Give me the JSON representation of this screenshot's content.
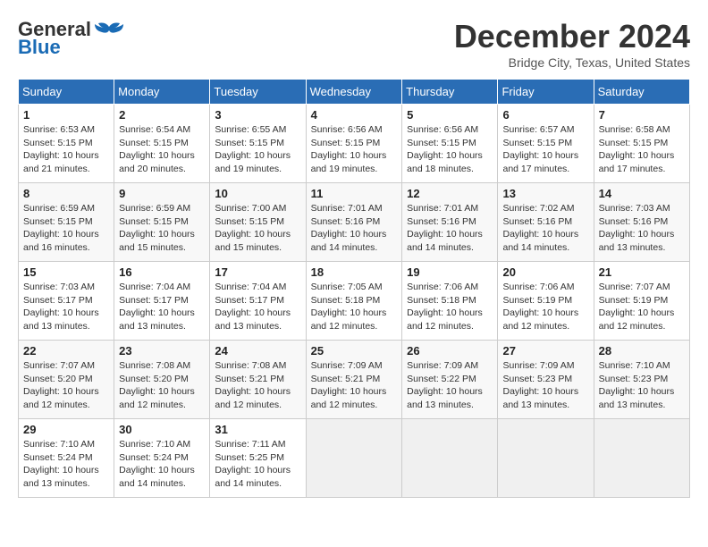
{
  "header": {
    "logo_general": "General",
    "logo_blue": "Blue",
    "month_title": "December 2024",
    "location": "Bridge City, Texas, United States"
  },
  "calendar": {
    "days_of_week": [
      "Sunday",
      "Monday",
      "Tuesday",
      "Wednesday",
      "Thursday",
      "Friday",
      "Saturday"
    ],
    "weeks": [
      [
        {
          "day": null,
          "empty": true
        },
        {
          "day": null,
          "empty": true
        },
        {
          "day": null,
          "empty": true
        },
        {
          "day": null,
          "empty": true
        },
        {
          "day": null,
          "empty": true
        },
        {
          "day": null,
          "empty": true
        },
        {
          "day": null,
          "empty": true
        }
      ],
      [
        {
          "day": 1,
          "sunrise": "6:53 AM",
          "sunset": "5:15 PM",
          "daylight": "10 hours and 21 minutes."
        },
        {
          "day": 2,
          "sunrise": "6:54 AM",
          "sunset": "5:15 PM",
          "daylight": "10 hours and 20 minutes."
        },
        {
          "day": 3,
          "sunrise": "6:55 AM",
          "sunset": "5:15 PM",
          "daylight": "10 hours and 19 minutes."
        },
        {
          "day": 4,
          "sunrise": "6:56 AM",
          "sunset": "5:15 PM",
          "daylight": "10 hours and 19 minutes."
        },
        {
          "day": 5,
          "sunrise": "6:56 AM",
          "sunset": "5:15 PM",
          "daylight": "10 hours and 18 minutes."
        },
        {
          "day": 6,
          "sunrise": "6:57 AM",
          "sunset": "5:15 PM",
          "daylight": "10 hours and 17 minutes."
        },
        {
          "day": 7,
          "sunrise": "6:58 AM",
          "sunset": "5:15 PM",
          "daylight": "10 hours and 17 minutes."
        }
      ],
      [
        {
          "day": 8,
          "sunrise": "6:59 AM",
          "sunset": "5:15 PM",
          "daylight": "10 hours and 16 minutes."
        },
        {
          "day": 9,
          "sunrise": "6:59 AM",
          "sunset": "5:15 PM",
          "daylight": "10 hours and 15 minutes."
        },
        {
          "day": 10,
          "sunrise": "7:00 AM",
          "sunset": "5:15 PM",
          "daylight": "10 hours and 15 minutes."
        },
        {
          "day": 11,
          "sunrise": "7:01 AM",
          "sunset": "5:16 PM",
          "daylight": "10 hours and 14 minutes."
        },
        {
          "day": 12,
          "sunrise": "7:01 AM",
          "sunset": "5:16 PM",
          "daylight": "10 hours and 14 minutes."
        },
        {
          "day": 13,
          "sunrise": "7:02 AM",
          "sunset": "5:16 PM",
          "daylight": "10 hours and 14 minutes."
        },
        {
          "day": 14,
          "sunrise": "7:03 AM",
          "sunset": "5:16 PM",
          "daylight": "10 hours and 13 minutes."
        }
      ],
      [
        {
          "day": 15,
          "sunrise": "7:03 AM",
          "sunset": "5:17 PM",
          "daylight": "10 hours and 13 minutes."
        },
        {
          "day": 16,
          "sunrise": "7:04 AM",
          "sunset": "5:17 PM",
          "daylight": "10 hours and 13 minutes."
        },
        {
          "day": 17,
          "sunrise": "7:04 AM",
          "sunset": "5:17 PM",
          "daylight": "10 hours and 13 minutes."
        },
        {
          "day": 18,
          "sunrise": "7:05 AM",
          "sunset": "5:18 PM",
          "daylight": "10 hours and 12 minutes."
        },
        {
          "day": 19,
          "sunrise": "7:06 AM",
          "sunset": "5:18 PM",
          "daylight": "10 hours and 12 minutes."
        },
        {
          "day": 20,
          "sunrise": "7:06 AM",
          "sunset": "5:19 PM",
          "daylight": "10 hours and 12 minutes."
        },
        {
          "day": 21,
          "sunrise": "7:07 AM",
          "sunset": "5:19 PM",
          "daylight": "10 hours and 12 minutes."
        }
      ],
      [
        {
          "day": 22,
          "sunrise": "7:07 AM",
          "sunset": "5:20 PM",
          "daylight": "10 hours and 12 minutes."
        },
        {
          "day": 23,
          "sunrise": "7:08 AM",
          "sunset": "5:20 PM",
          "daylight": "10 hours and 12 minutes."
        },
        {
          "day": 24,
          "sunrise": "7:08 AM",
          "sunset": "5:21 PM",
          "daylight": "10 hours and 12 minutes."
        },
        {
          "day": 25,
          "sunrise": "7:09 AM",
          "sunset": "5:21 PM",
          "daylight": "10 hours and 12 minutes."
        },
        {
          "day": 26,
          "sunrise": "7:09 AM",
          "sunset": "5:22 PM",
          "daylight": "10 hours and 13 minutes."
        },
        {
          "day": 27,
          "sunrise": "7:09 AM",
          "sunset": "5:23 PM",
          "daylight": "10 hours and 13 minutes."
        },
        {
          "day": 28,
          "sunrise": "7:10 AM",
          "sunset": "5:23 PM",
          "daylight": "10 hours and 13 minutes."
        }
      ],
      [
        {
          "day": 29,
          "sunrise": "7:10 AM",
          "sunset": "5:24 PM",
          "daylight": "10 hours and 13 minutes."
        },
        {
          "day": 30,
          "sunrise": "7:10 AM",
          "sunset": "5:24 PM",
          "daylight": "10 hours and 14 minutes."
        },
        {
          "day": 31,
          "sunrise": "7:11 AM",
          "sunset": "5:25 PM",
          "daylight": "10 hours and 14 minutes."
        },
        {
          "day": null,
          "empty": true
        },
        {
          "day": null,
          "empty": true
        },
        {
          "day": null,
          "empty": true
        },
        {
          "day": null,
          "empty": true
        }
      ]
    ]
  }
}
